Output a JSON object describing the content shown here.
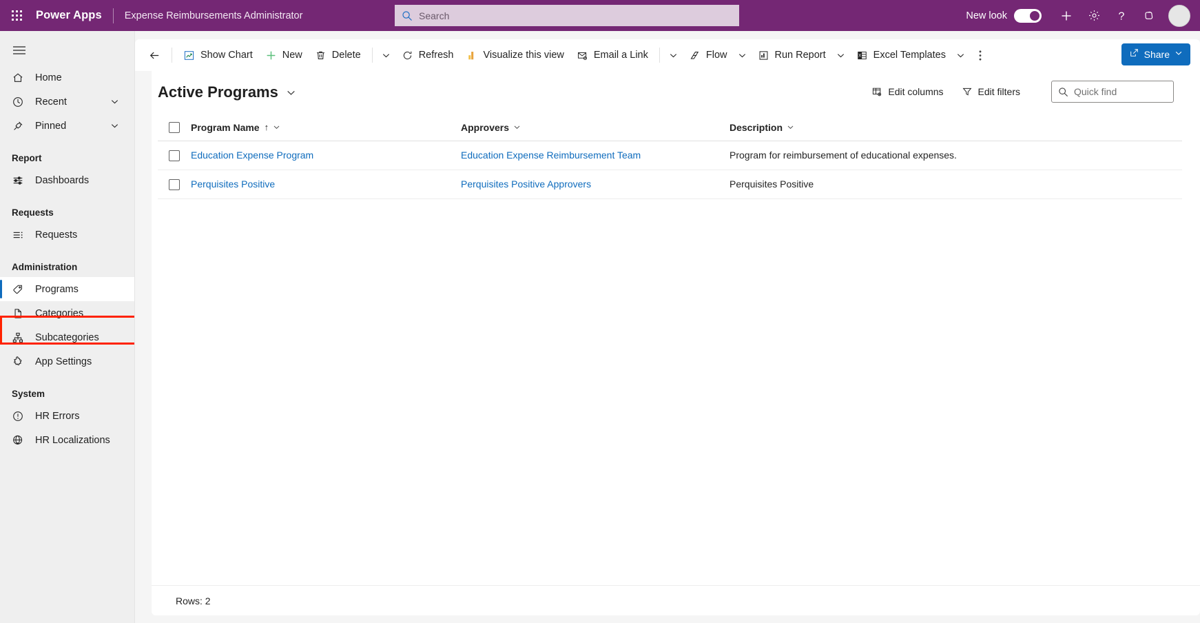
{
  "header": {
    "waffle_name": "app-launcher",
    "brand": "Power Apps",
    "app_name": "Expense Reimbursements Administrator",
    "search_placeholder": "Search",
    "search_value": "",
    "new_look_label": "New look",
    "new_look_on": true,
    "icons": [
      "plus-icon",
      "gear-icon",
      "help-icon",
      "copilot-icon",
      "avatar"
    ],
    "brand_color": "#742774",
    "search_bg": "#ddccdd"
  },
  "sidebar": {
    "hamburger_name": "site-map-toggle",
    "top_items": [
      {
        "label": "Home",
        "icon": "home-icon",
        "chevron": false
      },
      {
        "label": "Recent",
        "icon": "clock-icon",
        "chevron": true
      },
      {
        "label": "Pinned",
        "icon": "pin-icon",
        "chevron": true
      }
    ],
    "groups": [
      {
        "title": "Report",
        "items": [
          {
            "label": "Dashboards",
            "icon": "dashboard-icon",
            "selected": false
          }
        ]
      },
      {
        "title": "Requests",
        "items": [
          {
            "label": "Requests",
            "icon": "list-icon",
            "selected": false
          }
        ]
      },
      {
        "title": "Administration",
        "items": [
          {
            "label": "Programs",
            "icon": "tag-icon",
            "selected": true
          },
          {
            "label": "Categories",
            "icon": "document-icon",
            "selected": false
          },
          {
            "label": "Subcategories",
            "icon": "hierarchy-icon",
            "selected": false
          },
          {
            "label": "App Settings",
            "icon": "puzzle-icon",
            "selected": false
          }
        ]
      },
      {
        "title": "System",
        "items": [
          {
            "label": "HR Errors",
            "icon": "alert-circle-icon",
            "selected": false
          },
          {
            "label": "HR Localizations",
            "icon": "globe-icon",
            "selected": false
          }
        ]
      }
    ],
    "highlight_color": "#ff2200",
    "selected_accent": "#0f6cbd"
  },
  "commandbar": {
    "back_name": "back-button",
    "buttons": [
      {
        "label": "Show Chart",
        "icon": "chart-icon",
        "caret": false
      },
      {
        "label": "New",
        "icon": "plus-green-icon",
        "caret": false
      },
      {
        "label": "Delete",
        "icon": "trash-icon",
        "caret": false
      },
      {
        "label": "",
        "icon": "chevron-down-icon",
        "caret": true
      },
      {
        "label": "Refresh",
        "icon": "refresh-icon",
        "caret": false
      },
      {
        "label": "Visualize this view",
        "icon": "visualize-icon",
        "caret": false
      },
      {
        "label": "Email a Link",
        "icon": "email-icon",
        "caret": false
      },
      {
        "label": "",
        "icon": "chevron-down-icon",
        "caret": true
      },
      {
        "label": "Flow",
        "icon": "flow-icon",
        "caret": true
      },
      {
        "label": "Run Report",
        "icon": "report-icon",
        "caret": true
      },
      {
        "label": "Excel Templates",
        "icon": "excel-icon",
        "caret": true
      }
    ],
    "overflow_name": "more-commands",
    "share": {
      "label": "Share",
      "icon": "share-icon",
      "color": "#0f6cbd"
    }
  },
  "view": {
    "title": "Active Programs",
    "edit_columns": "Edit columns",
    "edit_filters": "Edit filters",
    "quickfind_placeholder": "Quick find",
    "quickfind_value": ""
  },
  "table": {
    "columns": [
      {
        "label": "Program Name",
        "sort": "↑"
      },
      {
        "label": "Approvers",
        "sort": ""
      },
      {
        "label": "Description",
        "sort": ""
      }
    ],
    "rows": [
      {
        "name": "Education Expense Program",
        "approvers": "Education Expense Reimbursement Team",
        "description": "Program for reimbursement of educational expenses."
      },
      {
        "name": "Perquisites Positive",
        "approvers": "Perquisites Positive Approvers",
        "description": "Perquisites Positive"
      }
    ],
    "footer": "Rows: 2"
  }
}
